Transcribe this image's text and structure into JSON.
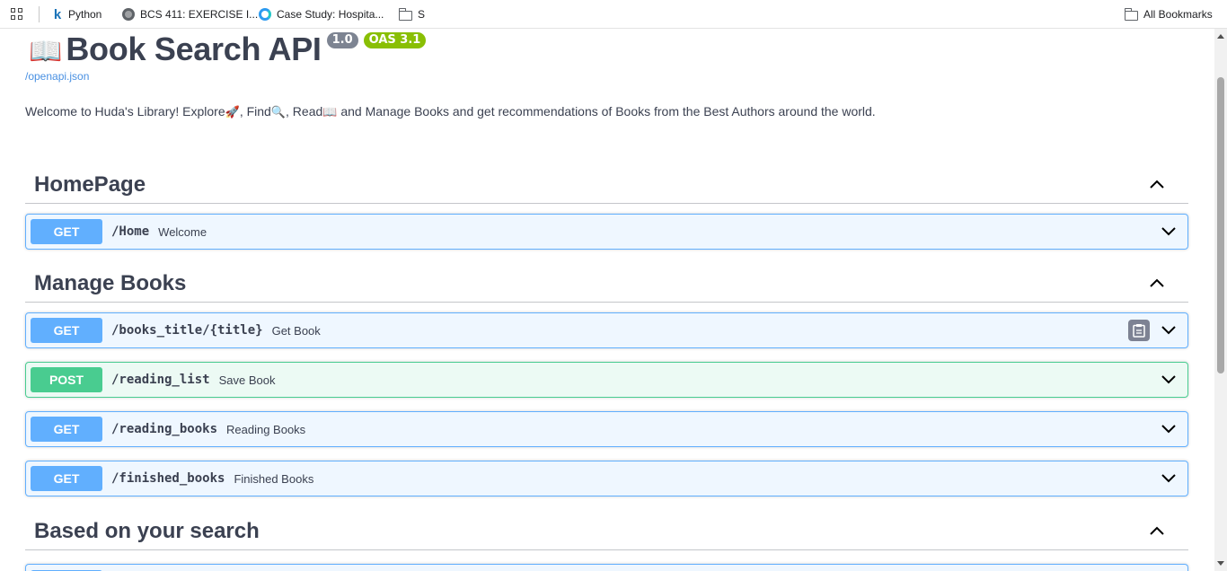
{
  "bookmarks": {
    "items": [
      {
        "label": "Python",
        "icon": "k-logo-icon"
      },
      {
        "label": "BCS 411: EXERCISE I...",
        "icon": "globe-icon"
      },
      {
        "label": "Case Study: Hospita...",
        "icon": "g-logo-icon"
      },
      {
        "label": "S",
        "icon": "folder-icon"
      }
    ],
    "all_bookmarks": "All Bookmarks"
  },
  "info": {
    "book_emoji": "📖",
    "title": "Book Search API",
    "version": "1.0",
    "oas": "OAS 3.1",
    "openapi_link": "/openapi.json",
    "description": {
      "part1": "Welcome to Huda's Library! Explore",
      "emoji1": "🚀",
      "part2": ", Find",
      "emoji2": "🔍",
      "part3": ", Read",
      "emoji3": "📖",
      "part4": " and Manage Books and get recommendations of Books from the Best Authors around the world."
    }
  },
  "tags": [
    {
      "name": "HomePage",
      "operations": [
        {
          "method": "GET",
          "path": "/Home",
          "summary": "Welcome"
        }
      ]
    },
    {
      "name": "Manage Books",
      "operations": [
        {
          "method": "GET",
          "path": "/books_title/{title}",
          "summary": "Get Book"
        },
        {
          "method": "POST",
          "path": "/reading_list",
          "summary": "Save Book"
        },
        {
          "method": "GET",
          "path": "/reading_books",
          "summary": "Reading Books"
        },
        {
          "method": "GET",
          "path": "/finished_books",
          "summary": "Finished Books"
        }
      ]
    },
    {
      "name": "Based on your search",
      "operations": []
    }
  ],
  "colors": {
    "get": "#61affe",
    "post": "#49cc90",
    "version_badge": "#7d8492",
    "oas_badge": "#89bf04",
    "link": "#4990e2"
  }
}
